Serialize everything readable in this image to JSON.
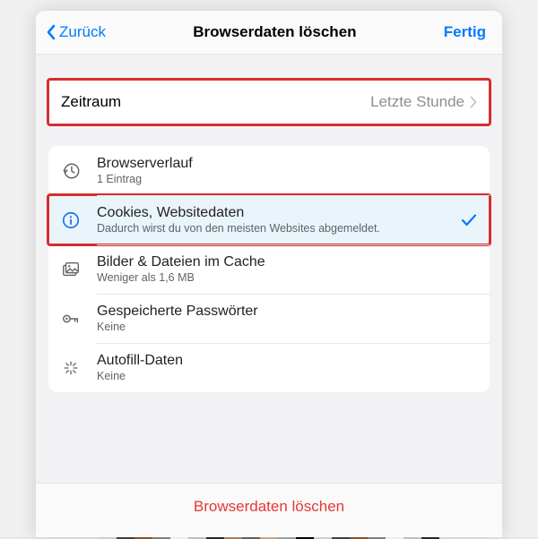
{
  "nav": {
    "back": "Zurück",
    "title": "Browserdaten löschen",
    "done": "Fertig"
  },
  "range": {
    "label": "Zeitraum",
    "value": "Letzte Stunde"
  },
  "items": [
    {
      "title": "Browserverlauf",
      "sub": "1 Eintrag",
      "selected": false,
      "icon": "history"
    },
    {
      "title": "Cookies, Websitedaten",
      "sub": "Dadurch wirst du von den meisten Websites abgemeldet.",
      "selected": true,
      "icon": "info"
    },
    {
      "title": "Bilder & Dateien im Cache",
      "sub": "Weniger als 1,6 MB",
      "selected": false,
      "icon": "images"
    },
    {
      "title": "Gespeicherte Passwörter",
      "sub": "Keine",
      "selected": false,
      "icon": "key"
    },
    {
      "title": "Autofill-Daten",
      "sub": "Keine",
      "selected": false,
      "icon": "autofill"
    }
  ],
  "action": "Browserdaten löschen"
}
